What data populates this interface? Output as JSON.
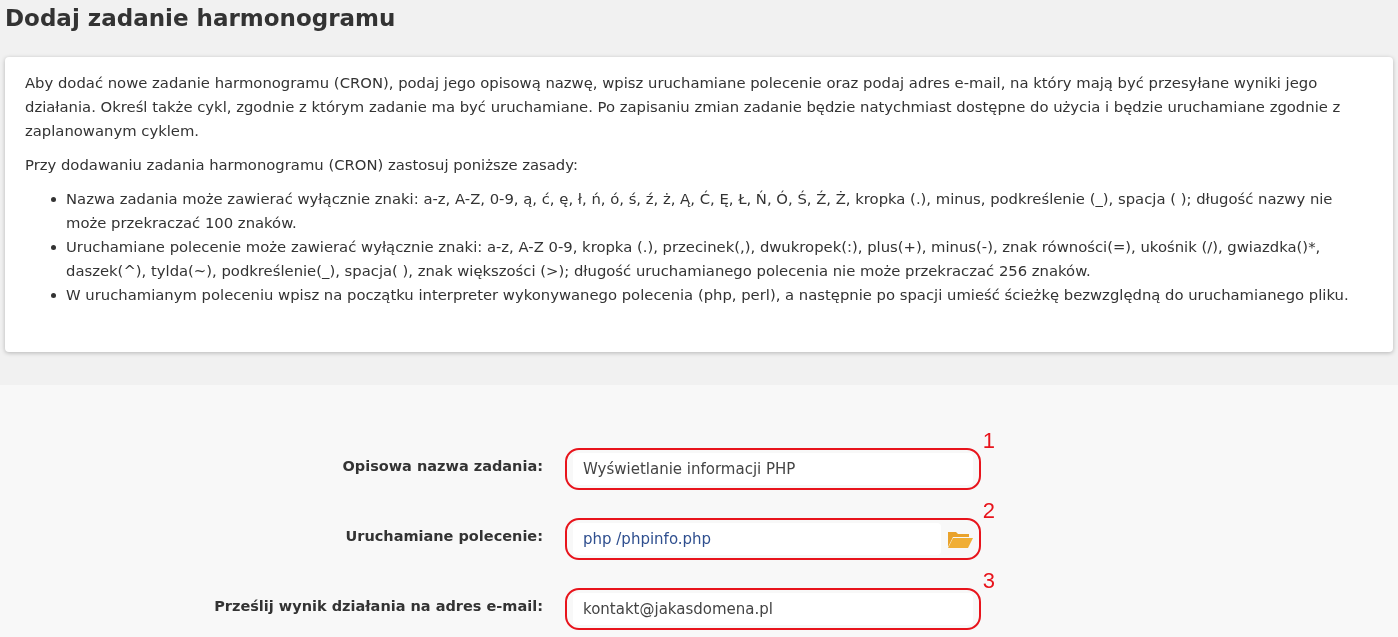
{
  "title": "Dodaj zadanie harmonogramu",
  "info": {
    "paragraphs": [
      "Aby dodać nowe zadanie harmonogramu (CRON), podaj jego opisową nazwę, wpisz uruchamiane polecenie oraz podaj adres e-mail, na który mają być przesyłane wyniki jego działania. Określ także cykl, zgodnie z którym zadanie ma być uruchamiane. Po zapisaniu zmian zadanie będzie natychmiast dostępne do użycia i będzie uruchamiane zgodnie z zaplanowanym cyklem.",
      "Przy dodawaniu zadania harmonogramu (CRON) zastosuj poniższe zasady:"
    ],
    "rules": [
      "Nazwa zadania może zawierać wyłącznie znaki: a-z, A-Z, 0-9, ą, ć, ę, ł, ń, ó, ś, ź, ż, Ą, Ć, Ę, Ł, Ń, Ó, Ś, Ź, Ż, kropka (.), minus, podkreślenie (_), spacja ( ); długość nazwy nie może przekraczać 100 znaków.",
      "Uruchamiane polecenie może zawierać wyłącznie znaki: a-z, A-Z 0-9, kropka (.), przecinek(,), dwukropek(:), plus(+), minus(-), znak równości(=), ukośnik (/), gwiazdka()*, daszek(^), tylda(~), podkreślenie(_), spacja( ), znak większości (>); długość uruchamianego polecenia nie może przekraczać 256 znaków.",
      "W uruchamianym poleceniu wpisz na początku interpreter wykonywanego polecenia (php, perl), a następnie po spacji umieść ścieżkę bezwzględną do uruchamianego pliku."
    ]
  },
  "form": [
    {
      "label": "Opisowa nazwa zadania:",
      "value": "Wyświetlanie informacji PHP",
      "kind": "text",
      "callout": "1"
    },
    {
      "label": "Uruchamiane polecenie:",
      "value": "php /phpinfo.php",
      "kind": "file",
      "callout": "2"
    },
    {
      "label": "Prześlij wynik działania na adres e-mail:",
      "value": "kontakt@jakasdomena.pl",
      "kind": "text",
      "callout": "3"
    }
  ]
}
